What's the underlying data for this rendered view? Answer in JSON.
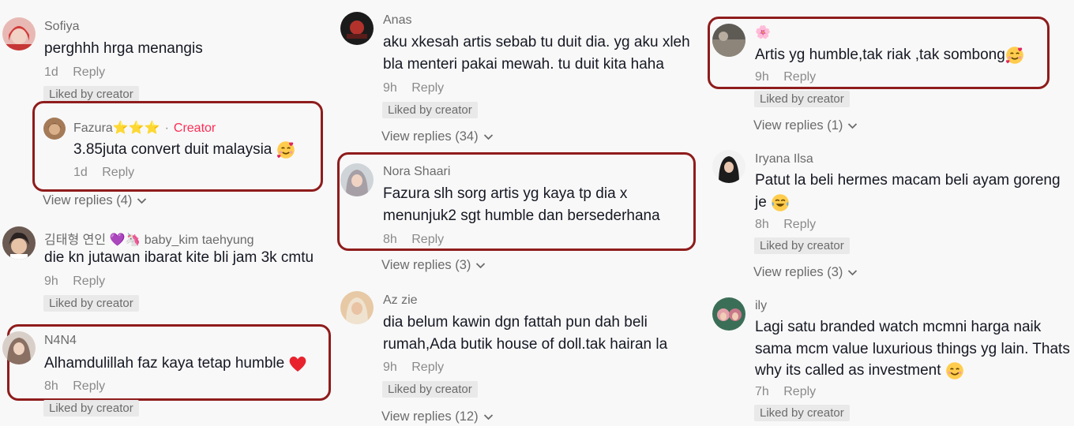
{
  "columns": [
    {
      "comments": [
        {
          "username": "Sofiya",
          "text_lines": [
            "perghhh hrga menangis"
          ],
          "time": "1d",
          "reply": "Reply",
          "liked": "Liked by creator"
        },
        {
          "username": "Fazura⭐⭐⭐",
          "creator_dot": "·",
          "creator_label": "Creator",
          "text_lines": [
            "3.85juta convert duit malaysia"
          ],
          "time": "1d",
          "reply": "Reply",
          "view_replies": "View replies (4)"
        },
        {
          "username": "김태형 연인 💜🦄 baby_kim taehyung",
          "text_lines": [
            "die kn jutawan ibarat kite bli jam 3k cmtu"
          ],
          "time": "9h",
          "reply": "Reply",
          "liked": "Liked by creator"
        },
        {
          "username": "N4N4",
          "text_lines": [
            "Alhamdulillah faz kaya tetap humble"
          ],
          "time": "8h",
          "reply": "Reply",
          "liked": "Liked by creator"
        }
      ]
    },
    {
      "comments": [
        {
          "username": "Anas",
          "text_lines": [
            "aku xkesah artis sebab tu duit dia. yg aku xleh",
            "bla menteri pakai mewah. tu duit kita haha"
          ],
          "time": "9h",
          "reply": "Reply",
          "liked": "Liked by creator",
          "view_replies": "View replies (34)"
        },
        {
          "username": "Nora Shaari",
          "text_lines": [
            "Fazura slh sorg artis yg kaya tp dia x",
            "menunjuk2 sgt humble dan bersederhana"
          ],
          "time": "8h",
          "reply": "Reply",
          "view_replies": "View replies (3)"
        },
        {
          "username": "Az zie",
          "text_lines": [
            "dia belum kawin dgn fattah pun dah beli",
            "rumah,Ada butik house of doll.tak hairan la"
          ],
          "time": "9h",
          "reply": "Reply",
          "liked": "Liked by creator",
          "view_replies": "View replies (12)"
        }
      ]
    },
    {
      "comments": [
        {
          "username": "🌸",
          "text_lines": [
            "Artis yg humble,tak riak ,tak sombong"
          ],
          "time": "9h",
          "reply": "Reply",
          "liked": "Liked by creator",
          "view_replies": "View replies (1)"
        },
        {
          "username": "Iryana Ilsa",
          "text_lines": [
            "Patut la beli hermes macam beli ayam goreng",
            "je"
          ],
          "time": "8h",
          "reply": "Reply",
          "liked": "Liked by creator",
          "view_replies": "View replies (3)"
        },
        {
          "username": "ily",
          "text_lines": [
            "Lagi satu branded watch mcmni harga naik",
            "sama mcm value luxurious things yg lain. Thats",
            "why its called as investment"
          ],
          "time": "7h",
          "reply": "Reply",
          "liked": "Liked by creator"
        }
      ]
    }
  ],
  "colors": {
    "highlight": "#8f1c1c",
    "creator": "#fe2c55",
    "liked_bg": "#e9e9e9",
    "muted": "#8a8a8a"
  },
  "icons": [
    "chevron-down-icon",
    "heart-emoji-icon",
    "smiling-hearts-emoji-icon",
    "laughing-tears-emoji-icon",
    "smile-emoji-icon",
    "purple-heart-emoji",
    "unicorn-emoji"
  ]
}
